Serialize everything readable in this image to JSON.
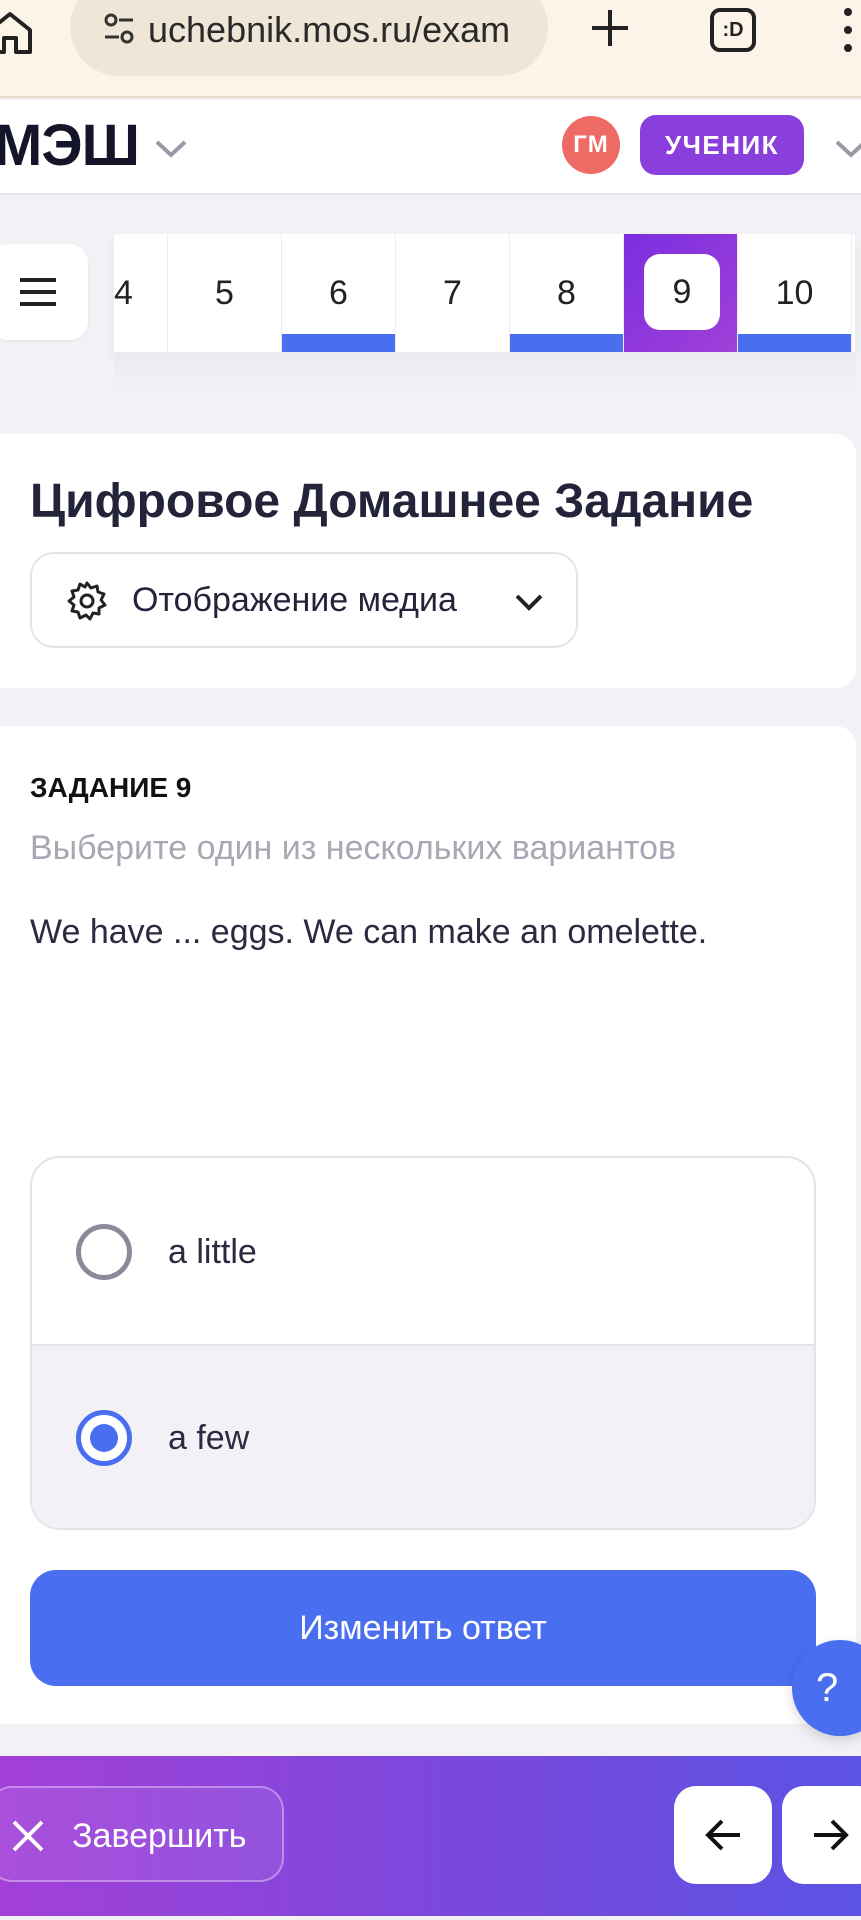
{
  "browser": {
    "url": "uchebnik.mos.ru/exam",
    "tabs_label": ":D"
  },
  "header": {
    "brand": "МЭШ",
    "avatar_initials": "ГМ",
    "role": "УЧЕНИК"
  },
  "questions": [
    {
      "label": "4",
      "done": false,
      "active": false
    },
    {
      "label": "5",
      "done": false,
      "active": false
    },
    {
      "label": "6",
      "done": true,
      "active": false
    },
    {
      "label": "7",
      "done": false,
      "active": false
    },
    {
      "label": "8",
      "done": true,
      "active": false
    },
    {
      "label": "9",
      "done": false,
      "active": true
    },
    {
      "label": "10",
      "done": true,
      "active": false
    }
  ],
  "title_card": {
    "title": "Цифровое Домашнее Задание",
    "media_button": "Отображение медиа"
  },
  "task": {
    "number": "ЗАДАНИЕ 9",
    "hint": "Выберите один из нескольких вариантов",
    "question": "We have ... eggs. We can make an omelette.",
    "options": [
      {
        "label": "a little",
        "selected": false
      },
      {
        "label": "a few",
        "selected": true
      }
    ],
    "submit_label": "Изменить ответ",
    "help_label": "?"
  },
  "footer": {
    "finish_label": "Завершить"
  },
  "colors": {
    "accent_blue": "#4a6ef0",
    "accent_purple": "#8a3fdd",
    "avatar_red": "#ee6a64"
  },
  "icons": [
    "home-icon",
    "site-settings-icon",
    "plus-icon",
    "tabs-icon",
    "menu-dots-icon",
    "chevron-down-icon",
    "hamburger-icon",
    "gear-icon",
    "close-icon",
    "arrow-left-icon",
    "arrow-right-icon"
  ]
}
